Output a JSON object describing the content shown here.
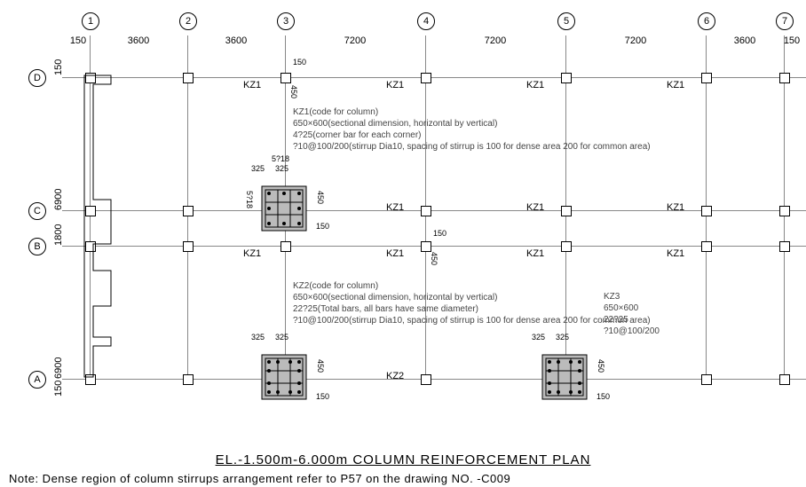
{
  "grid": {
    "cols": [
      "1",
      "2",
      "3",
      "4",
      "5",
      "6",
      "7"
    ],
    "rows": [
      "D",
      "C",
      "B",
      "A"
    ],
    "col_spans": [
      "150",
      "3600",
      "3600",
      "7200",
      "7200",
      "7200",
      "3600",
      "150"
    ],
    "row_spans": [
      "150",
      "6900",
      "1800",
      "6900",
      "150"
    ]
  },
  "labels": {
    "kz1": "KZ1",
    "kz2": "KZ2",
    "kz3": "KZ3"
  },
  "kz1": {
    "code": "KZ1(code for column)",
    "section": "650×600(sectional dimension, horizontal by vertical)",
    "corner": "4?25(corner bar for each corner)",
    "stirrup": "?10@100/200(stirrup Dia10, spacing of stirrup is 100 for dense area 200 for common area)",
    "bar_note": "5?18",
    "side_note": "5?18",
    "dim1": "325",
    "dim2": "325",
    "h": "450",
    "small": "150"
  },
  "kz2": {
    "code": "KZ2(code for column)",
    "section": "650×600(sectional dimension, horizontal by vertical)",
    "bars": "22?25(Total bars, all bars have same diameter)",
    "stirrup": "?10@100/200(stirrup Dia10, spacing of stirrup is 100 for dense area 200 for common area)",
    "dim1": "325",
    "dim2": "325",
    "h": "450",
    "small": "150"
  },
  "kz3": {
    "name": "KZ3",
    "section": "650×600",
    "bars": "22?25",
    "stirrup": "?10@100/200",
    "dim1": "325",
    "dim2": "325",
    "h": "450",
    "small": "150"
  },
  "dims_small": {
    "d150": "150",
    "d450": "450"
  },
  "title": "EL.-1.500m-6.000m COLUMN REINFORCEMENT PLAN",
  "footnote": "Note: Dense region of column stirrups arrangement refer to P57 on the drawing NO. -C009",
  "chart_data": {
    "type": "diagram",
    "description": "Structural column reinforcement plan",
    "grid_x": {
      "marks": [
        "1",
        "2",
        "3",
        "4",
        "5",
        "6",
        "7"
      ],
      "spacing": [
        3600,
        3600,
        7200,
        7200,
        7200,
        3600
      ],
      "edge": 150
    },
    "grid_y": {
      "marks": [
        "D",
        "C",
        "B",
        "A"
      ],
      "spacing": [
        6900,
        1800,
        6900
      ],
      "edge": 150
    },
    "columns": [
      {
        "id": "KZ1",
        "size": "650x600",
        "corner_bars": "4?25",
        "side_bars": "5?18",
        "stirrup": "?10@100/200"
      },
      {
        "id": "KZ2",
        "size": "650x600",
        "total_bars": "22?25",
        "stirrup": "?10@100/200"
      },
      {
        "id": "KZ3",
        "size": "650x600",
        "total_bars": "22?25",
        "stirrup": "?10@100/200"
      }
    ]
  }
}
